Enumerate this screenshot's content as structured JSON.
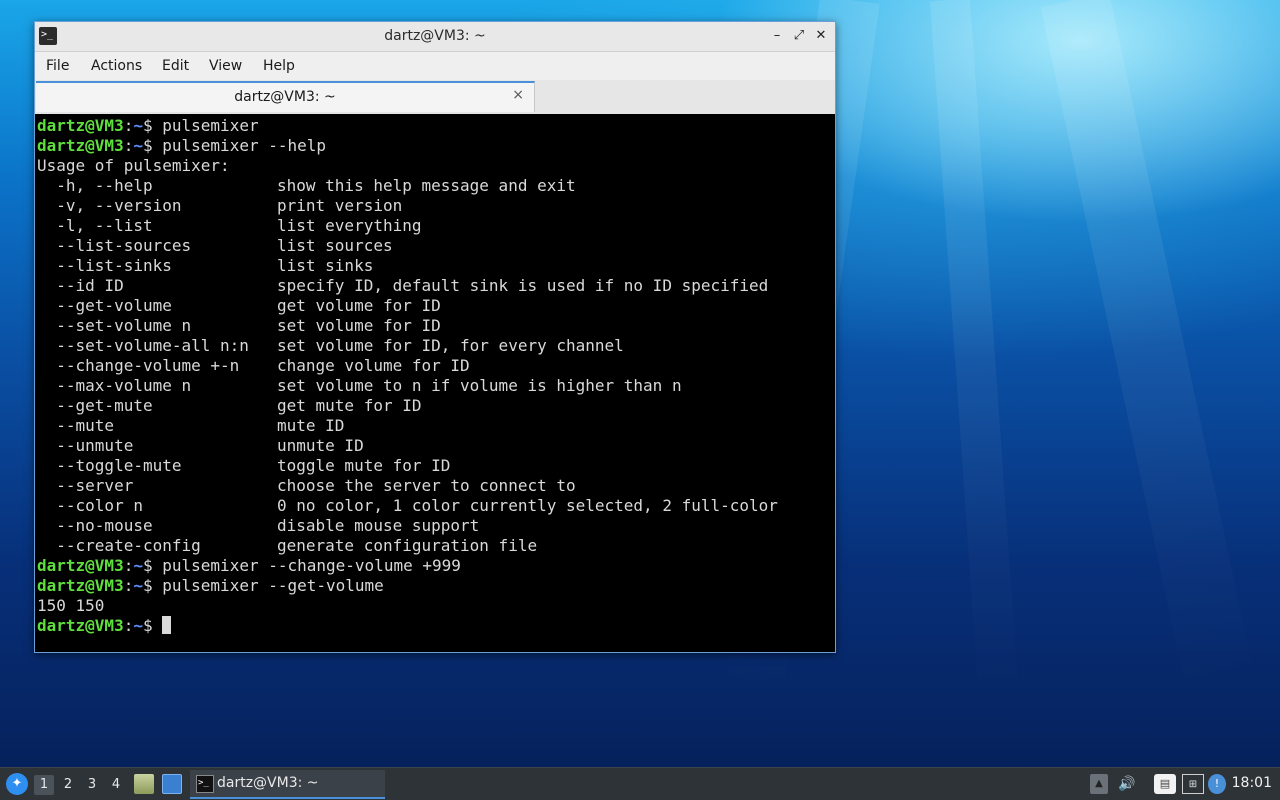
{
  "window": {
    "title": "dartz@VM3: ~",
    "icon": "terminal-icon",
    "buttons": {
      "minimize": "–",
      "maximize": "⤢",
      "close": "✕"
    }
  },
  "menu": [
    "File",
    "Actions",
    "Edit",
    "View",
    "Help"
  ],
  "tab": {
    "label": "dartz@VM3: ~",
    "close": "×"
  },
  "prompt": {
    "user_host": "dartz@VM3",
    "path": "~",
    "symbol": "$"
  },
  "terminal": {
    "cmd1": " pulsemixer",
    "cmd2": " pulsemixer --help",
    "usage": "Usage of pulsemixer:",
    "options": [
      {
        "flag": "  -h, --help",
        "desc": "show this help message and exit"
      },
      {
        "flag": "  -v, --version",
        "desc": "print version"
      },
      {
        "flag": "  -l, --list",
        "desc": "list everything"
      },
      {
        "flag": "  --list-sources",
        "desc": "list sources"
      },
      {
        "flag": "  --list-sinks",
        "desc": "list sinks"
      },
      {
        "flag": "  --id ID",
        "desc": "specify ID, default sink is used if no ID specified"
      },
      {
        "flag": "  --get-volume",
        "desc": "get volume for ID"
      },
      {
        "flag": "  --set-volume n",
        "desc": "set volume for ID"
      },
      {
        "flag": "  --set-volume-all n:n",
        "desc": "set volume for ID, for every channel"
      },
      {
        "flag": "  --change-volume +-n",
        "desc": "change volume for ID"
      },
      {
        "flag": "  --max-volume n",
        "desc": "set volume to n if volume is higher than n"
      },
      {
        "flag": "  --get-mute",
        "desc": "get mute for ID"
      },
      {
        "flag": "  --mute",
        "desc": "mute ID"
      },
      {
        "flag": "  --unmute",
        "desc": "unmute ID"
      },
      {
        "flag": "  --toggle-mute",
        "desc": "toggle mute for ID"
      },
      {
        "flag": "  --server",
        "desc": "choose the server to connect to"
      },
      {
        "flag": "  --color n",
        "desc": "0 no color, 1 color currently selected, 2 full-color"
      },
      {
        "flag": "  --no-mouse",
        "desc": "disable mouse support"
      },
      {
        "flag": "  --create-config",
        "desc": "generate configuration file"
      }
    ],
    "cmd3": " pulsemixer --change-volume +999",
    "cmd4": " pulsemixer --get-volume",
    "output": "150 150"
  },
  "taskbar": {
    "start_icon": "lubuntu-start-icon",
    "workspaces": [
      "1",
      "2",
      "3",
      "4"
    ],
    "task_label": "dartz@VM3: ~",
    "clock": "18:01",
    "colors": {
      "accent": "#4a90d9",
      "prompt_user": "#5fdf3d",
      "prompt_path": "#5c8dff"
    }
  }
}
